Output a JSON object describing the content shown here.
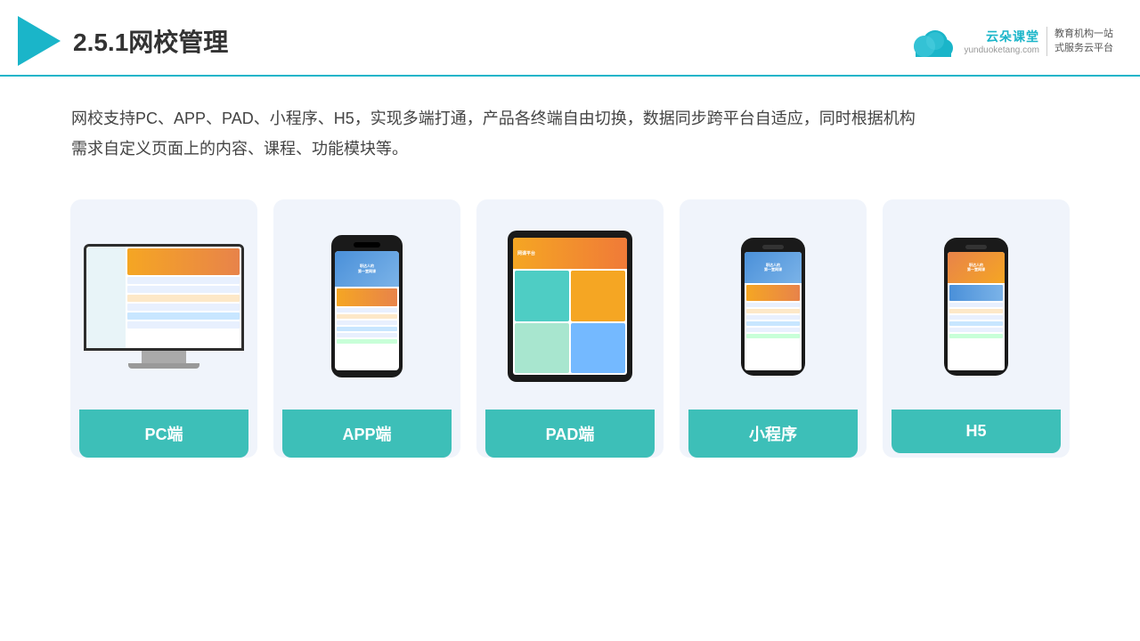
{
  "header": {
    "title": "2.5.1网校管理",
    "brand": {
      "name": "云朵课堂",
      "url": "yunduoketang.com",
      "tagline": "教育机构一站\n式服务云平台"
    }
  },
  "description": {
    "text": "网校支持PC、APP、PAD、小程序、H5，实现多端打通，产品各终端自由切换，数据同步跨平台自适应，同时根据机构\n需求自定义页面上的内容、课程、功能模块等。"
  },
  "cards": [
    {
      "id": "pc",
      "label": "PC端"
    },
    {
      "id": "app",
      "label": "APP端"
    },
    {
      "id": "pad",
      "label": "PAD端"
    },
    {
      "id": "miniapp",
      "label": "小程序"
    },
    {
      "id": "h5",
      "label": "H5"
    }
  ],
  "colors": {
    "accent": "#1ab5c9",
    "card_bg": "#f0f4fb",
    "card_label_bg": "#3dbfb8",
    "text_dark": "#333",
    "text_body": "#444"
  }
}
